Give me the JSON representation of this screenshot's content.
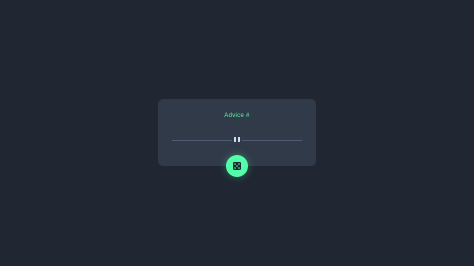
{
  "card": {
    "advice_label": "Advice #",
    "advice_text": ""
  },
  "icons": {
    "divider": "pause-icon",
    "button": "dice-icon"
  },
  "colors": {
    "background": "#202632",
    "card": "#313a49",
    "accent": "#52ffa8",
    "text": "#cee3e9",
    "divider": "#4f5d74"
  }
}
